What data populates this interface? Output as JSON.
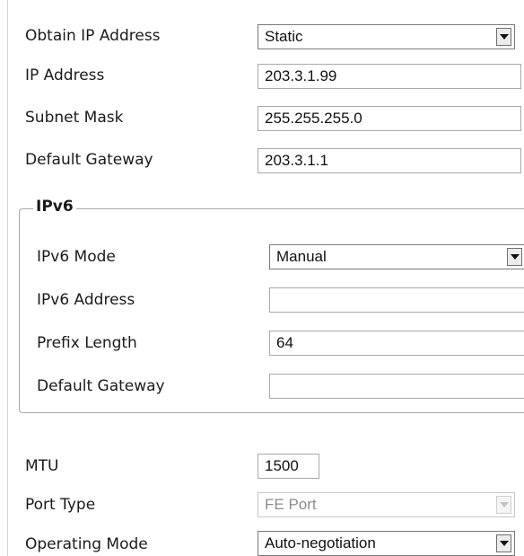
{
  "network": {
    "obtain_ip": {
      "label": "Obtain IP Address",
      "value": "Static"
    },
    "ip_address": {
      "label": "IP Address",
      "value": "203.3.1.99"
    },
    "subnet_mask": {
      "label": "Subnet Mask",
      "value": "255.255.255.0"
    },
    "default_gateway": {
      "label": "Default Gateway",
      "value": "203.3.1.1"
    }
  },
  "ipv6": {
    "legend": "IPv6",
    "mode": {
      "label": "IPv6 Mode",
      "value": "Manual"
    },
    "address": {
      "label": "IPv6 Address",
      "value": ""
    },
    "prefix_length": {
      "label": "Prefix Length",
      "value": "64"
    },
    "default_gateway": {
      "label": "Default Gateway",
      "value": ""
    }
  },
  "mtu": {
    "label": "MTU",
    "value": "1500"
  },
  "port_type": {
    "label": "Port Type",
    "value": "FE Port"
  },
  "operating_mode": {
    "label": "Operating Mode",
    "value": "Auto-negotiation"
  },
  "icons": {
    "dropdown": "chevron-down-icon"
  }
}
